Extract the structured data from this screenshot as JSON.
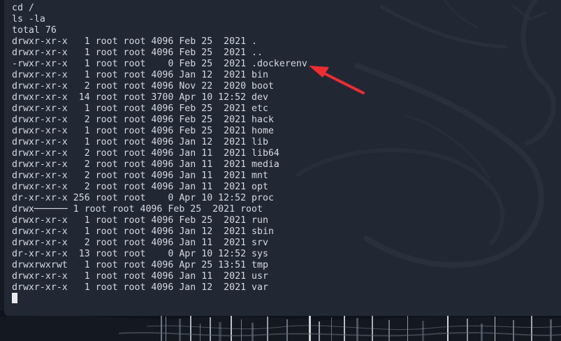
{
  "terminal": {
    "lines": [
      "cd /",
      "ls -la",
      "total 76",
      "drwxr-xr-x   1 root root 4096 Feb 25  2021 .",
      "drwxr-xr-x   1 root root 4096 Feb 25  2021 ..",
      "-rwxr-xr-x   1 root root    0 Feb 25  2021 .dockerenv",
      "drwxr-xr-x   1 root root 4096 Jan 12  2021 bin",
      "drwxr-xr-x   2 root root 4096 Nov 22  2020 boot",
      "drwxr-xr-x  14 root root 3700 Apr 10 12:52 dev",
      "drwxr-xr-x   1 root root 4096 Feb 25  2021 etc",
      "drwxr-xr-x   2 root root 4096 Feb 25  2021 hack",
      "drwxr-xr-x   1 root root 4096 Feb 25  2021 home",
      "drwxr-xr-x   1 root root 4096 Jan 12  2021 lib",
      "drwxr-xr-x   2 root root 4096 Jan 11  2021 lib64",
      "drwxr-xr-x   2 root root 4096 Jan 11  2021 media",
      "drwxr-xr-x   2 root root 4096 Jan 11  2021 mnt",
      "drwxr-xr-x   2 root root 4096 Jan 11  2021 opt",
      "dr-xr-xr-x 256 root root    0 Apr 10 12:52 proc",
      "drwx────── 1 root root 4096 Feb 25  2021 root",
      "drwxr-xr-x   1 root root 4096 Feb 25  2021 run",
      "drwxr-xr-x   1 root root 4096 Jan 12  2021 sbin",
      "drwxr-xr-x   2 root root 4096 Jan 11  2021 srv",
      "dr-xr-xr-x  13 root root    0 Apr 10 12:52 sys",
      "drwxrwxrwt   1 root root 4096 Apr 25 13:51 tmp",
      "drwxr-xr-x   1 root root 4096 Jan 11  2021 usr",
      "drwxr-xr-x   1 root root 4096 Jan 12  2021 var"
    ]
  },
  "colors": {
    "terminal_background": "#212834",
    "terminal_text": "#d5d9df",
    "arrow": "#ed2d32",
    "desktop_background": "#141922"
  },
  "icons": {
    "annotation": "red-arrow-icon",
    "background": "dragon-wallpaper-icon"
  }
}
